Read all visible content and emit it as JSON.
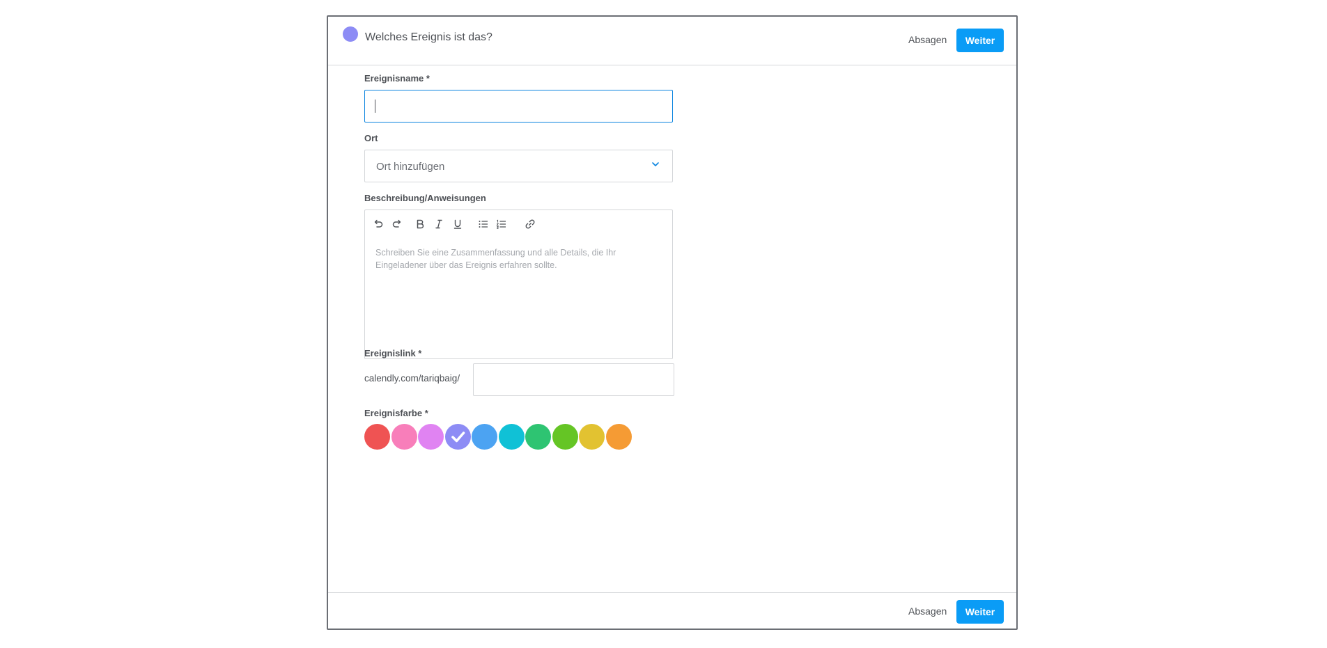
{
  "header": {
    "title": "Welches Ereignis ist das?",
    "event_color": "#8d8cf5",
    "cancel_label": "Absagen",
    "next_label": "Weiter"
  },
  "form": {
    "name_label": "Ereignisname *",
    "name_value": "",
    "location_label": "Ort",
    "location_value": "Ort hinzufügen",
    "description_label": "Beschreibung/Anweisungen",
    "description_placeholder": "Schreiben Sie eine Zusammenfassung und alle Details, die Ihr Eingeladener über das Ereignis erfahren sollte.",
    "toolbar_icons": [
      "undo-icon",
      "redo-icon",
      "bold-icon",
      "italic-icon",
      "underline-icon",
      "bulleted-list-icon",
      "numbered-list-icon",
      "link-icon"
    ],
    "link_label": "Ereignislink *",
    "link_prefix": "calendly.com/tariqbaig/",
    "link_value": "",
    "color_label": "Ereignisfarbe *",
    "colors": [
      {
        "hex": "#ef5353",
        "selected": false
      },
      {
        "hex": "#f87eba",
        "selected": false
      },
      {
        "hex": "#e083f2",
        "selected": false
      },
      {
        "hex": "#8d8cf5",
        "selected": true
      },
      {
        "hex": "#4ca3f2",
        "selected": false
      },
      {
        "hex": "#10c1d6",
        "selected": false
      },
      {
        "hex": "#2ec472",
        "selected": false
      },
      {
        "hex": "#65c525",
        "selected": false
      },
      {
        "hex": "#e2c231",
        "selected": false
      },
      {
        "hex": "#f59b34",
        "selected": false
      }
    ]
  },
  "footer": {
    "cancel_label": "Absagen",
    "next_label": "Weiter"
  }
}
